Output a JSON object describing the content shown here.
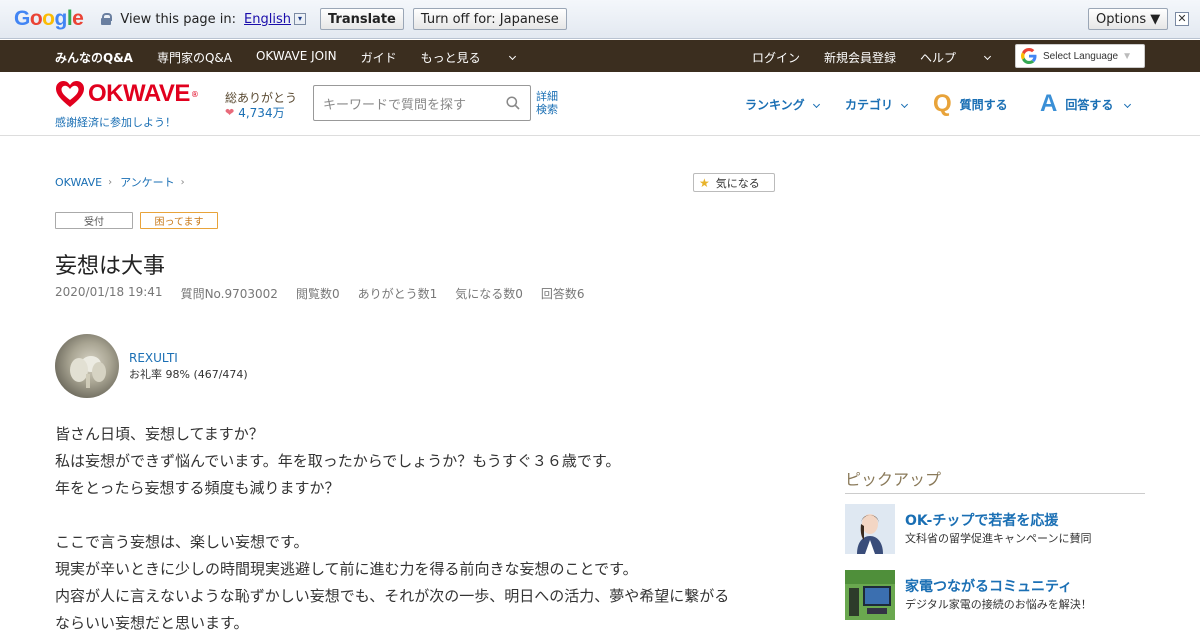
{
  "google_bar": {
    "logo": "Google",
    "prompt": "View this page in:",
    "language": "English",
    "dropdown": "▾",
    "translate": "Translate",
    "turn_off": "Turn off for: Japanese",
    "options": "Options ▼",
    "close": "✕"
  },
  "top_nav": {
    "left": [
      "みんなのQ&A",
      "専門家のQ&A",
      "OKWAVE JOIN",
      "ガイド",
      "もっと見る"
    ],
    "right": [
      "ログイン",
      "新規会員登録",
      "ヘルプ"
    ],
    "select_language": "Select Language",
    "select_language_arrow": "▼"
  },
  "header": {
    "logo": "OKWAVE",
    "logo_reg": "®",
    "tagline": "感謝経済に参加しよう！",
    "thanks_label": "総ありがとう",
    "thanks_count": "4,734万",
    "search_placeholder": "キーワードで質問を探す",
    "detail_search_1": "詳細",
    "detail_search_2": "検索",
    "ranking": "ランキング",
    "category": "カテゴリ",
    "ask_letter": "Q",
    "ask": "質問する",
    "answer_letter": "A",
    "answer": "回答する"
  },
  "breadcrumb": [
    "OKWAVE",
    "アンケート"
  ],
  "breadcrumb_sep": "›",
  "bookmark_button": "気になる",
  "tags": [
    "受付",
    "困ってます"
  ],
  "question": {
    "title": "妄想は大事",
    "date": "2020/01/18 19:41",
    "number": "質問No.9703002",
    "views": "閲覧数0",
    "thanks": "ありがとう数1",
    "bookmarks": "気になる数0",
    "answers": "回答数6"
  },
  "user": {
    "name": "REXULTI",
    "rate": "お礼率 98%  (467/474)"
  },
  "body_lines": [
    "皆さん日頃、妄想してますか？",
    "私は妄想ができず悩んでいます。年を取ったからでしょうか？もうすぐ３６歳です。",
    "年をとったら妄想する頻度も減りますか？",
    "",
    "ここで言う妄想は、楽しい妄想です。",
    "現実が辛いときに少しの時間現実逃避して前に進む力を得る前向きな妄想のことです。",
    "内容が人に言えないような恥ずかしい妄想でも、それが次の一歩、明日への活力、夢や希望に繋がる",
    "ならいい妄想だと思います。"
  ],
  "pickup": {
    "heading": "ピックアップ",
    "items": [
      {
        "title": "OK-チップで若者を応援",
        "desc": "文科省の留学促進キャンペーンに賛同"
      },
      {
        "title": "家電つながるコミュニティ",
        "desc": "デジタル家電の接続のお悩みを解決！"
      }
    ]
  },
  "colors": {
    "brand_red": "#e1001e",
    "link_blue": "#1a6fb4",
    "nav_brown": "#3b2e1f"
  }
}
